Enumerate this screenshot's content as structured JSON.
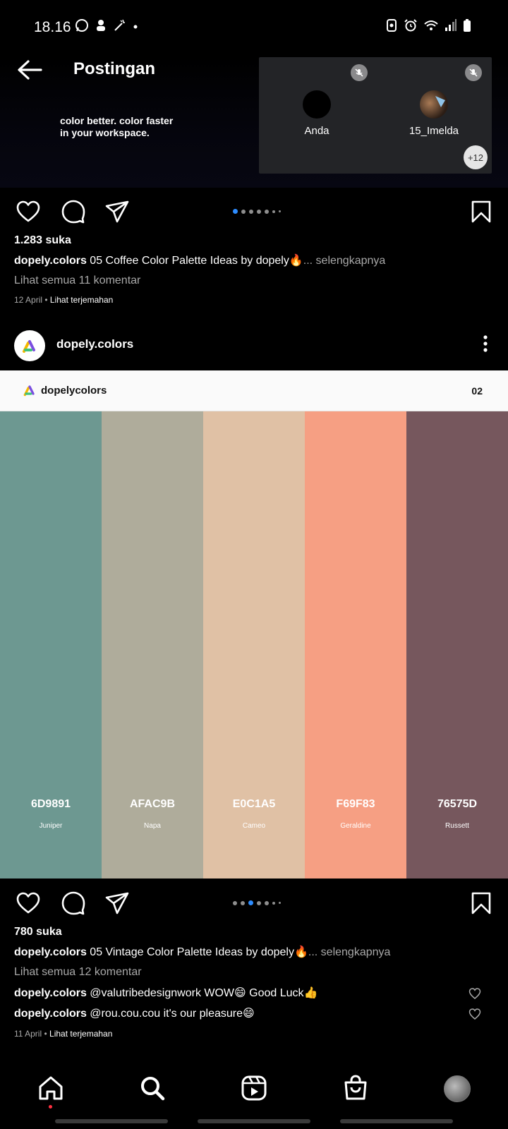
{
  "status_bar": {
    "time": "18.16",
    "left_icons": [
      "whatsapp-icon",
      "notification-icon",
      "magic-icon",
      "dot-icon"
    ],
    "right_icons": [
      "nfc-icon",
      "alarm-icon",
      "wifi-icon",
      "signal-icon",
      "battery-icon"
    ]
  },
  "header": {
    "title": "Postingan",
    "promo_line1": "color better. color faster",
    "promo_line2": "in your workspace."
  },
  "call": {
    "participants": [
      {
        "name": "Anda",
        "muted": true
      },
      {
        "name": "15_Imelda",
        "muted": true
      }
    ],
    "more_count": "+12"
  },
  "post1": {
    "likes": "1.283 suka",
    "username": "dopely.colors",
    "caption": " 05 Coffee Color Palette Ideas by dopely🔥",
    "more": "... selengkapnya",
    "view_comments": "Lihat semua 11 komentar",
    "date": "12 April",
    "translate": "Lihat terjemahan",
    "carousel_total": 7,
    "carousel_active": 0
  },
  "post2": {
    "username": "dopely.colors",
    "image": {
      "brand": "dopelycolors",
      "slide_number": "02",
      "swatches": [
        {
          "hex": "6D9891",
          "name": "Juniper",
          "color": "#6D9891"
        },
        {
          "hex": "AFAC9B",
          "name": "Napa",
          "color": "#AFAC9B"
        },
        {
          "hex": "E0C1A5",
          "name": "Cameo",
          "color": "#E0C1A5"
        },
        {
          "hex": "F69F83",
          "name": "Geraldine",
          "color": "#F69F83"
        },
        {
          "hex": "76575D",
          "name": "Russett",
          "color": "#76575D"
        }
      ]
    },
    "likes": "780 suka",
    "caption": " 05 Vintage Color Palette Ideas by dopely🔥",
    "more": "... selengkapnya",
    "view_comments": "Lihat semua 12 komentar",
    "comments": [
      {
        "user": "dopely.colors",
        "text": " @valutribedesignwork WOW😄 Good Luck👍"
      },
      {
        "user": "dopely.colors",
        "text": " @rou.cou.cou it's our pleasure😄"
      }
    ],
    "date": "11 April",
    "translate": "Lihat terjemahan",
    "carousel_total": 7,
    "carousel_active": 2
  },
  "bottom_nav": [
    "home-icon",
    "search-icon",
    "reels-icon",
    "shop-icon",
    "profile-avatar"
  ],
  "colors": {
    "accent": "#2d8cff",
    "notification": "#ff3040",
    "muted_text": "#a8a8a8"
  }
}
